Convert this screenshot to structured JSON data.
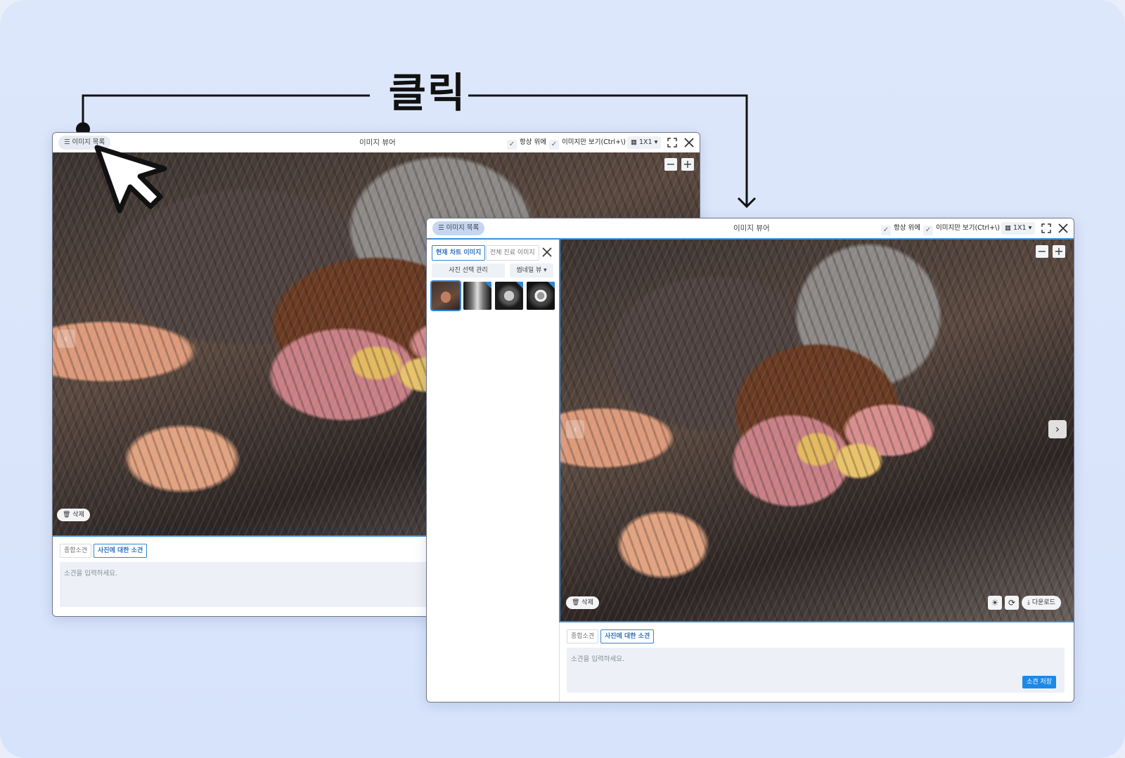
{
  "annotation": {
    "click_label": "클릭"
  },
  "viewer_back": {
    "image_list_button": "이미지 목록",
    "title": "이미지 뷰어",
    "always_on_top": "항상 위에",
    "image_only": "이미지만 보기(Ctrl+\\)",
    "layout": "1X1",
    "delete_button": "삭제",
    "tabs": [
      "종합소견",
      "사진에 대한 소견"
    ],
    "note_placeholder": "소견을 입력하세요."
  },
  "viewer_front": {
    "image_list_button": "이미지 목록",
    "title": "이미지 뷰어",
    "always_on_top": "항상 위에",
    "image_only": "이미지만 보기(Ctrl+\\)",
    "layout": "1X1",
    "sidebar": {
      "tabs": [
        "현재 차트 이미지",
        "전체 진료 이미지"
      ],
      "photo_select": "사진 선택 관리",
      "view_mode": "썸네일 뷰"
    },
    "delete_button": "삭제",
    "download_button": "다운로드",
    "tabs": [
      "종합소견",
      "사진에 대한 소견"
    ],
    "note_placeholder": "소견을 입력하세요.",
    "save_button": "소견 저장"
  },
  "colors": {
    "accent": "#2f86d6",
    "save": "#1e88e5",
    "background": "#dae5fb"
  }
}
